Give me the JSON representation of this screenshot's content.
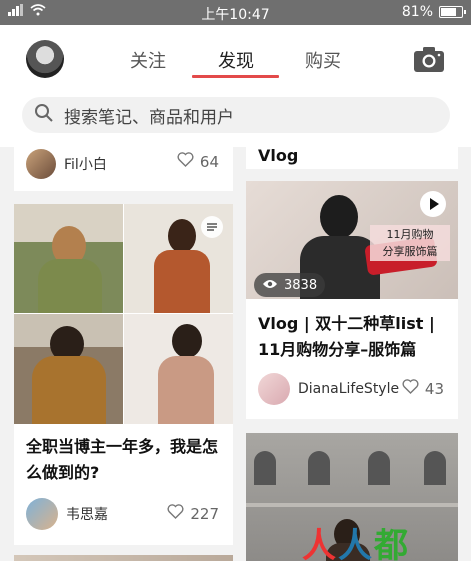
{
  "status_bar": {
    "time": "上午10:47",
    "battery": "81%",
    "battery_level": 0.81
  },
  "header": {
    "tabs": [
      {
        "label": "关注"
      },
      {
        "label": "发现"
      },
      {
        "label": "购买"
      }
    ],
    "active_tab": "发现",
    "search_placeholder": "搜索笔记、商品和用户"
  },
  "feed": {
    "left": [
      {
        "user": "Fil小白",
        "likes": "64"
      },
      {
        "title": "全职当博主一年多，我是怎么做到的?",
        "user": "韦思嘉",
        "likes": "227"
      }
    ],
    "right": [
      {
        "title_top": "Vlog"
      },
      {
        "overlay_text": "11月购物分享服饰篇",
        "views": "3838",
        "title": "Vlog | 双十二种草list | 11月购物分享–服饰篇",
        "user": "DianaLifeStyle",
        "likes": "43"
      }
    ]
  },
  "watermark": "人人都是产品经理",
  "colors": {
    "accent": "#e34a4a",
    "status_bar": "#6f6f6f"
  }
}
